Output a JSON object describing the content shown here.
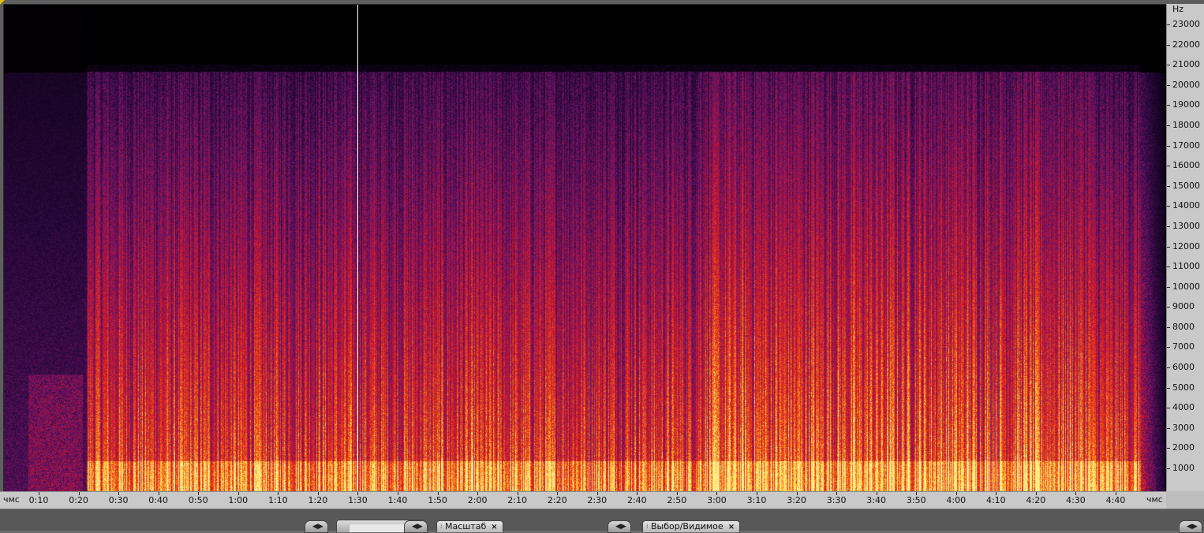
{
  "frequency_axis": {
    "unit": "Hz",
    "ticks": [
      "23000",
      "22000",
      "21000",
      "20000",
      "19000",
      "18000",
      "17000",
      "16000",
      "15000",
      "14000",
      "13000",
      "12000",
      "11000",
      "10000",
      "9000",
      "8000",
      "7000",
      "6000",
      "5000",
      "4000",
      "3000",
      "2000",
      "1000"
    ]
  },
  "time_axis": {
    "unit_left": "чмс",
    "unit_right": "чмс",
    "ticks": [
      "0:10",
      "0:20",
      "0:30",
      "0:40",
      "0:50",
      "1:00",
      "1:10",
      "1:20",
      "1:30",
      "1:40",
      "1:50",
      "2:00",
      "2:10",
      "2:20",
      "2:30",
      "2:40",
      "2:50",
      "3:00",
      "3:10",
      "3:20",
      "3:30",
      "3:40",
      "3:50",
      "4:00",
      "4:10",
      "4:20",
      "4:30",
      "4:40"
    ]
  },
  "panels": {
    "zoom_tab": {
      "label": "Масштаб",
      "close": "×"
    },
    "selection_tab": {
      "label": "Выбор/Видимое",
      "close": "×"
    },
    "nav_icon": "play-arrow-icon"
  },
  "colors": {
    "background": "#000000",
    "spectrum_low": "#2a0a3a",
    "spectrum_mid": "#c0142a",
    "spectrum_high": "#ffe070",
    "playhead": "#ffffff"
  }
}
